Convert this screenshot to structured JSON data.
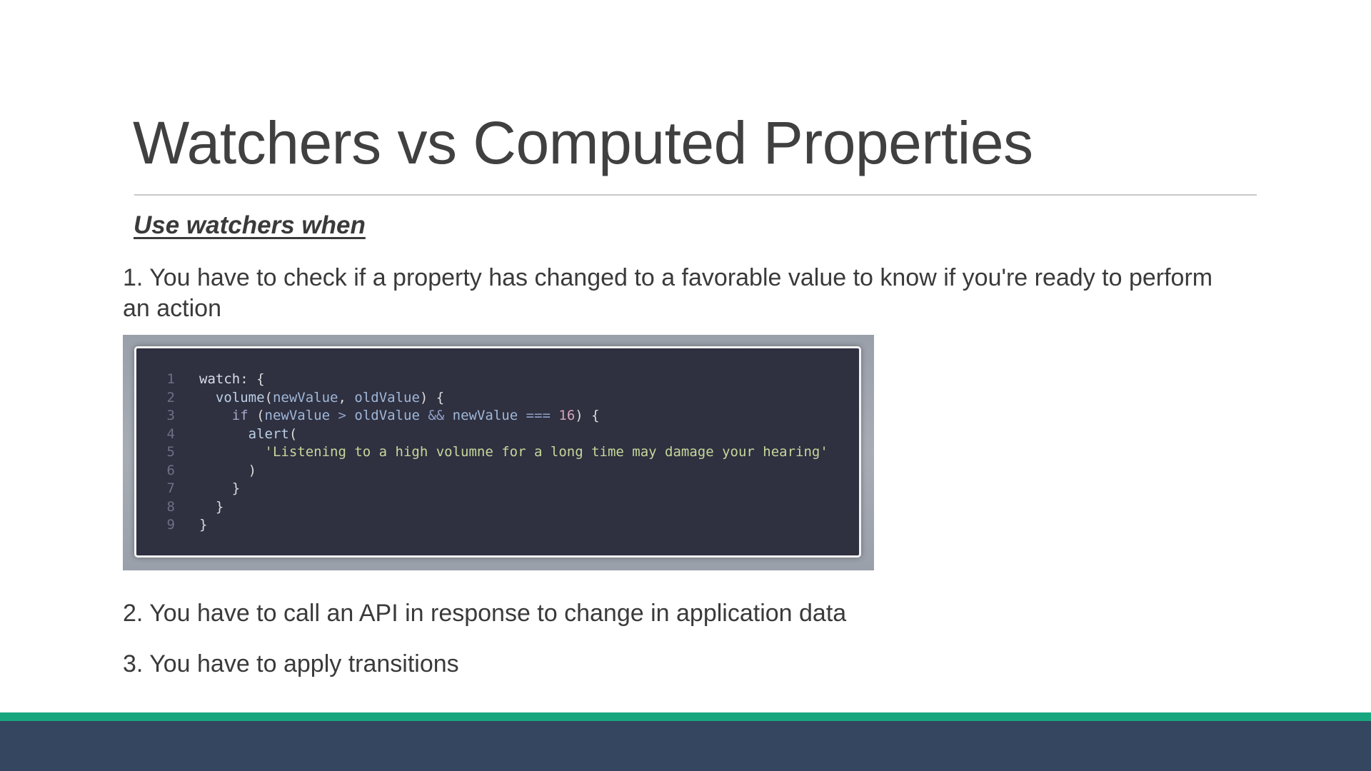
{
  "slide": {
    "title": "Watchers vs Computed Properties",
    "subheading": "Use watchers when",
    "points": [
      "1. You have to check if a property has changed to a favorable value to know if you're ready to perform an action",
      "2. You have to call an API in response to change in application data",
      "3. You have to apply transitions"
    ]
  },
  "code": {
    "language": "javascript",
    "lines": [
      {
        "number": "1",
        "tokens": [
          {
            "t": "watch",
            "c": "key"
          },
          {
            "t": ": {",
            "c": "plain"
          }
        ]
      },
      {
        "number": "2",
        "tokens": [
          {
            "t": "  ",
            "c": "plain"
          },
          {
            "t": "volume",
            "c": "fn"
          },
          {
            "t": "(",
            "c": "plain"
          },
          {
            "t": "newValue",
            "c": "param"
          },
          {
            "t": ", ",
            "c": "plain"
          },
          {
            "t": "oldValue",
            "c": "param"
          },
          {
            "t": ") {",
            "c": "plain"
          }
        ]
      },
      {
        "number": "3",
        "tokens": [
          {
            "t": "    ",
            "c": "plain"
          },
          {
            "t": "if",
            "c": "kw"
          },
          {
            "t": " (",
            "c": "plain"
          },
          {
            "t": "newValue",
            "c": "param"
          },
          {
            "t": " > ",
            "c": "op"
          },
          {
            "t": "oldValue",
            "c": "param"
          },
          {
            "t": " && ",
            "c": "op"
          },
          {
            "t": "newValue",
            "c": "param"
          },
          {
            "t": " === ",
            "c": "op"
          },
          {
            "t": "16",
            "c": "num"
          },
          {
            "t": ") {",
            "c": "plain"
          }
        ]
      },
      {
        "number": "4",
        "tokens": [
          {
            "t": "      ",
            "c": "plain"
          },
          {
            "t": "alert",
            "c": "fn"
          },
          {
            "t": "(",
            "c": "plain"
          }
        ]
      },
      {
        "number": "5",
        "tokens": [
          {
            "t": "        ",
            "c": "plain"
          },
          {
            "t": "'Listening to a high volumne for a long time may damage your hearing'",
            "c": "str"
          }
        ]
      },
      {
        "number": "6",
        "tokens": [
          {
            "t": "      )",
            "c": "plain"
          }
        ]
      },
      {
        "number": "7",
        "tokens": [
          {
            "t": "    }",
            "c": "plain"
          }
        ]
      },
      {
        "number": "8",
        "tokens": [
          {
            "t": "  }",
            "c": "plain"
          }
        ]
      },
      {
        "number": "9",
        "tokens": [
          {
            "t": "}",
            "c": "plain"
          }
        ]
      }
    ]
  },
  "colors": {
    "footer_accent": "#18a67f",
    "footer_bar": "#344660",
    "code_background": "#2f3040"
  }
}
